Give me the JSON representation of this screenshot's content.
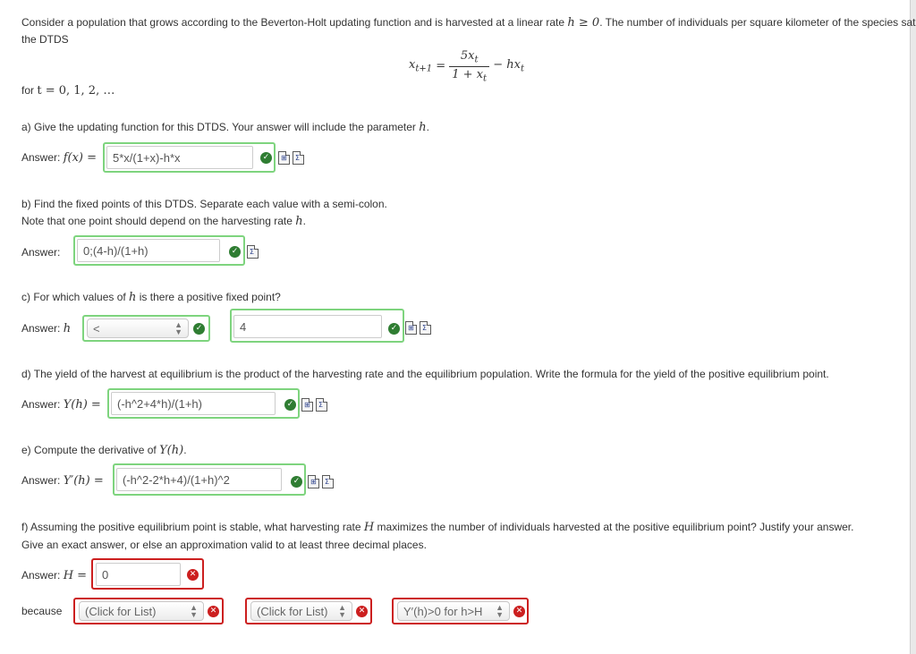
{
  "intro": {
    "line1_a": "Consider a population that grows according to the Beverton-Holt updating function and is harvested at a linear rate ",
    "line1_math": "h ≥ 0",
    "line1_b": ". The number of individuals per square kilometer of the species satisfies",
    "line2": "the DTDS",
    "eq_lhs": "x",
    "eq_lhs_sub": "t+1",
    "eq_eq": " = ",
    "eq_num": "5x",
    "eq_num_sub": "t",
    "eq_den": "1 + x",
    "eq_den_sub": "t",
    "eq_tail": " − hx",
    "eq_tail_sub": "t",
    "for_text": "for ",
    "for_math": "t = 0, 1, 2, …"
  },
  "qa": {
    "prompt_a": "a) Give the updating function for this DTDS. Your answer will include the parameter ",
    "prompt_b": "h",
    "prompt_c": ".",
    "label": "Answer: ",
    "label_math": "f(x) =",
    "value": "5*x/(1+x)-h*x"
  },
  "qb": {
    "prompt1": "b) Find the fixed points of this DTDS. Separate each value with a semi-colon.",
    "prompt2_a": "Note that one point should depend on the harvesting rate ",
    "prompt2_b": "h",
    "prompt2_c": ".",
    "label": "Answer:",
    "value": "0;(4-h)/(1+h)"
  },
  "qc": {
    "prompt_a": "c) For which values of ",
    "prompt_b": "h",
    "prompt_c": " is there a positive fixed point?",
    "label": "Answer: ",
    "label_math": "h",
    "select_value": "<",
    "value": "4"
  },
  "qd": {
    "prompt": "d) The yield of the harvest at equilibrium is the product of the harvesting rate and the equilibrium population. Write the formula for the yield of the positive equilibrium point.",
    "label": "Answer: ",
    "label_math": "Y(h) =",
    "value": "(-h^2+4*h)/(1+h)"
  },
  "qe": {
    "prompt_a": "e) Compute the derivative of ",
    "prompt_b": "Y(h)",
    "prompt_c": ".",
    "label": "Answer: ",
    "label_math": "Y′(h) =",
    "value": "(-h^2-2*h+4)/(1+h)^2"
  },
  "qf": {
    "prompt1_a": "f) Assuming the positive equilibrium point is stable, what harvesting rate ",
    "prompt1_b": "H",
    "prompt1_c": " maximizes the number of individuals harvested at the positive equilibrium point? Justify your answer.",
    "prompt2": "Give an exact answer, or else an approximation valid to at least three decimal places.",
    "label": "Answer: ",
    "label_math": "H =",
    "value": "0",
    "because_label": "because",
    "select1": "(Click for List)",
    "select2": "(Click for List)",
    "select3": "Y′(h)>0 for h>H"
  },
  "icons": {
    "correct": "check-circle-icon",
    "incorrect": "x-circle-icon",
    "equation_editor": "equation-editor-icon",
    "preview": "preview-sigma-icon"
  },
  "colors": {
    "correct_border": "#7ed47e",
    "incorrect_border": "#cc1f1f",
    "correct_icon": "#2f7d32"
  }
}
